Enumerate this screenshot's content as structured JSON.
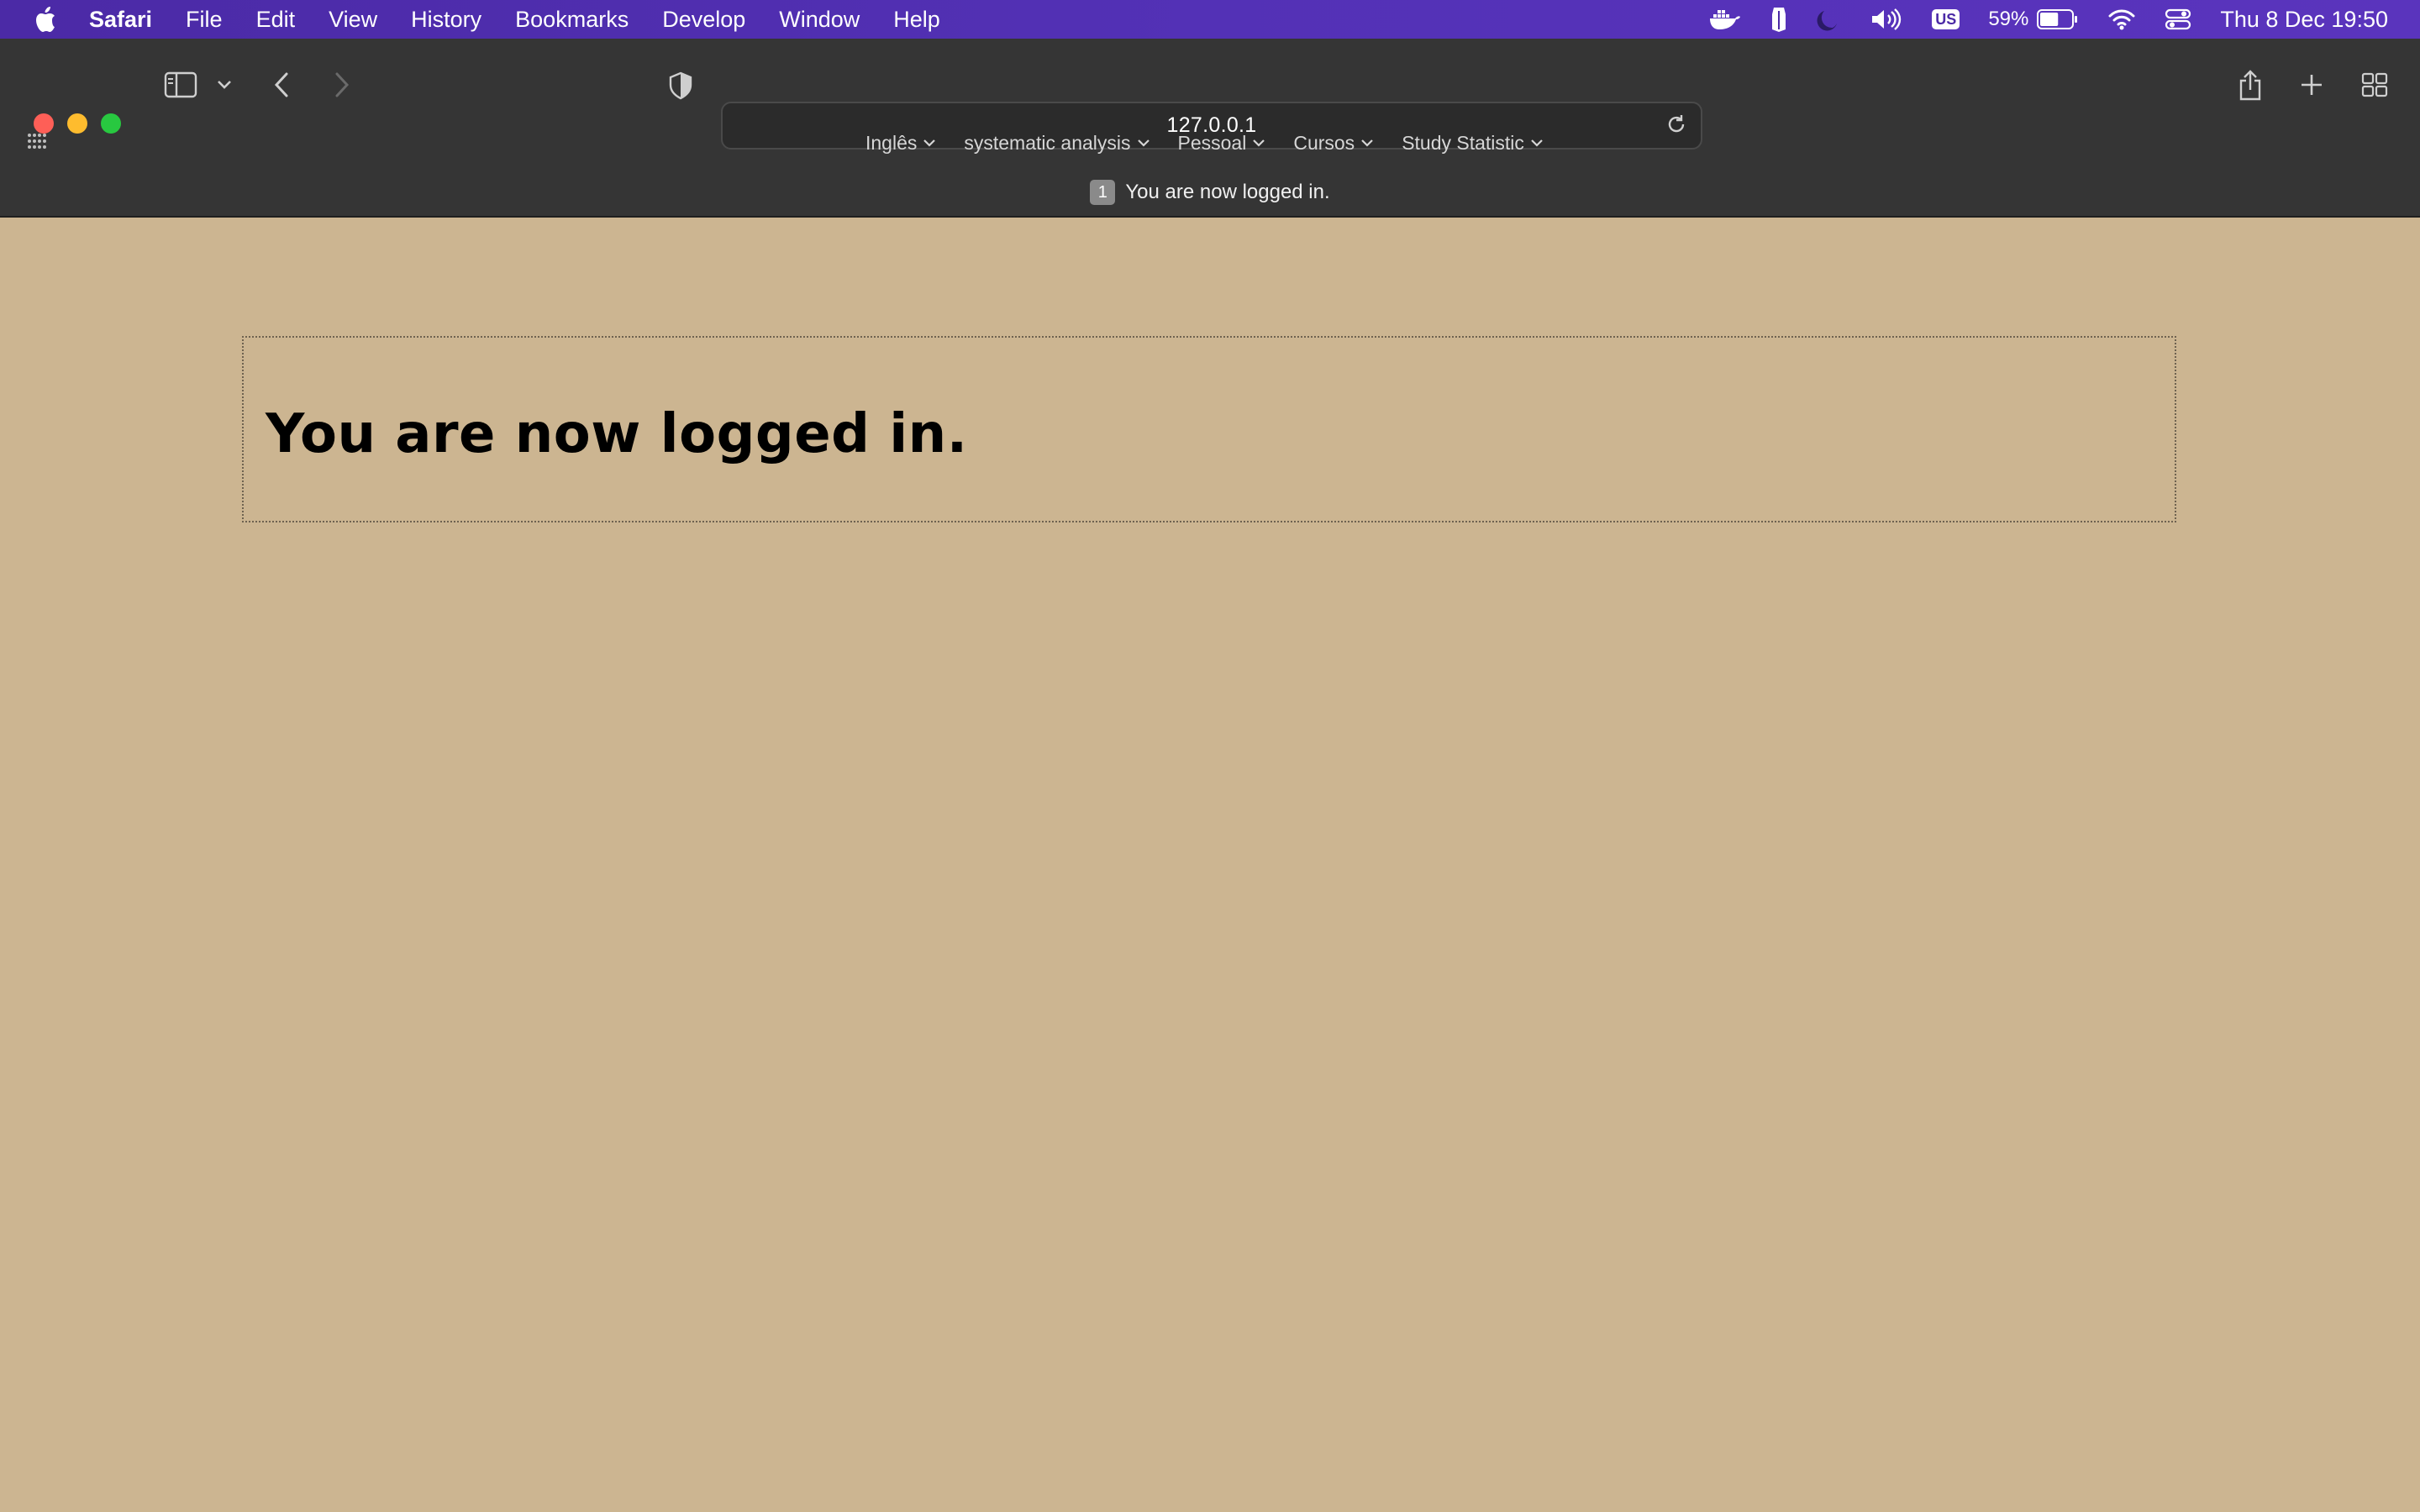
{
  "menubar": {
    "apple_icon": "apple-icon",
    "app_name": "Safari",
    "items": [
      "File",
      "Edit",
      "View",
      "History",
      "Bookmarks",
      "Develop",
      "Window",
      "Help"
    ],
    "status": {
      "icons": [
        "docker-icon",
        "gpu-icon",
        "moon-icon",
        "volume-icon",
        "keyboard-layout-icon",
        "battery-icon",
        "wifi-icon",
        "control-center-icon"
      ],
      "keyboard_layout": "US",
      "battery_percent": "59%",
      "battery_level": 0.59,
      "clock": "Thu 8 Dec  19:50"
    }
  },
  "toolbar": {
    "url": "127.0.0.1",
    "icons": [
      "sidebar-icon",
      "chevron-down-icon",
      "back-icon",
      "forward-icon",
      "shield-icon",
      "reload-icon",
      "share-icon",
      "new-tab-icon",
      "tab-overview-icon",
      "favorites-grid-icon"
    ]
  },
  "favorites": [
    "Inglês",
    "systematic analysis",
    "Pessoal",
    "Cursos",
    "Study Statistic"
  ],
  "tab": {
    "badge": "1",
    "title": "You are now logged in."
  },
  "page": {
    "heading": "You are now logged in."
  },
  "colors": {
    "menubar": "#4b2aa6",
    "toolbar": "#353535",
    "page_background": "#ccb591",
    "close": "#fe5f57",
    "minimize": "#febc2e",
    "maximize": "#28c840"
  }
}
